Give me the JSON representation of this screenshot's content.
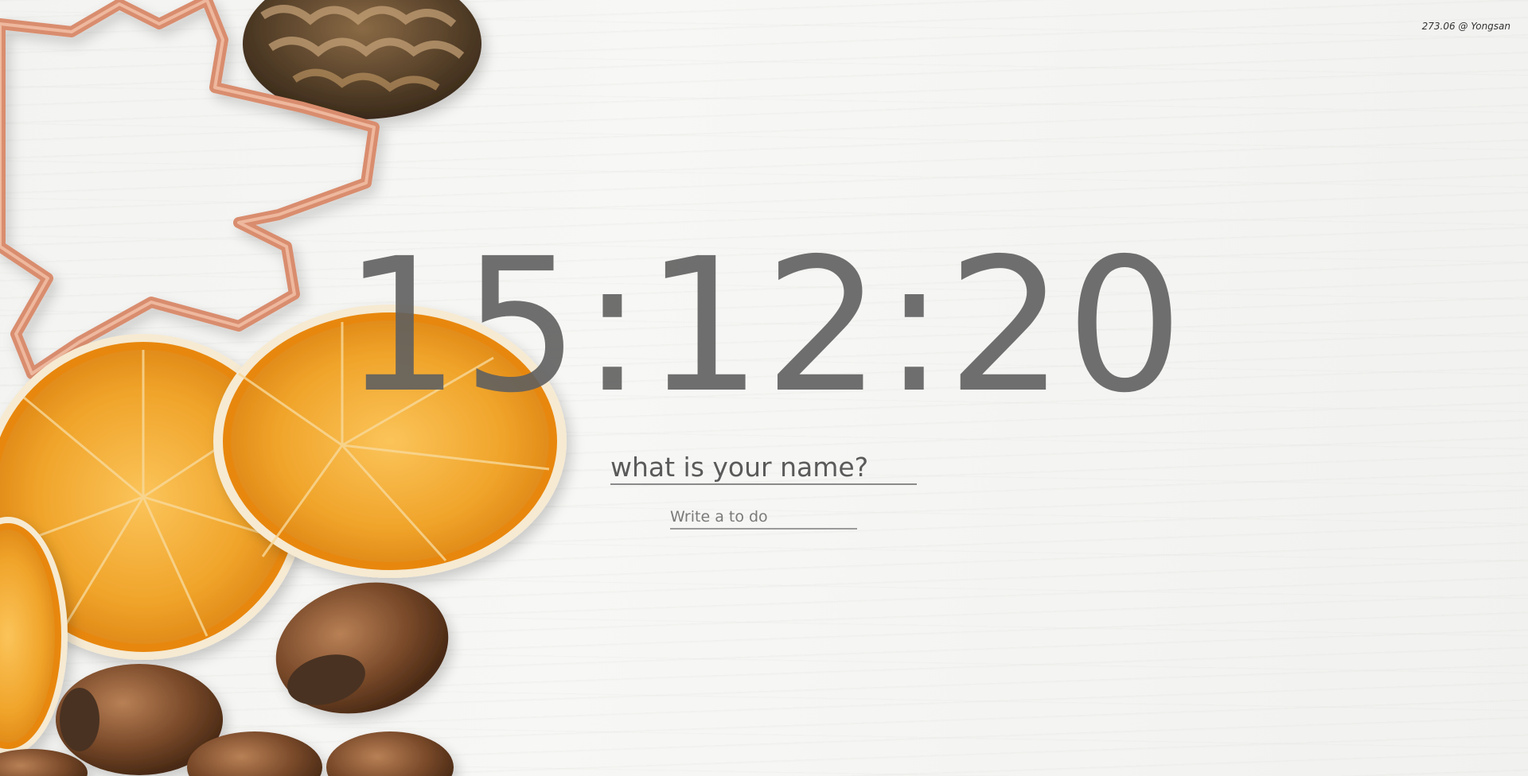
{
  "weather": {
    "text": "273.06 @ Yongsan"
  },
  "clock": {
    "time": "15:12:20"
  },
  "greeting_form": {
    "placeholder": "what is your name?"
  },
  "todo_form": {
    "placeholder": "Write a to do"
  },
  "background": {
    "icons": [
      "cookie-cutter-icon",
      "pinecone-icon",
      "orange-slice-icon",
      "hazelnut-icon"
    ]
  }
}
